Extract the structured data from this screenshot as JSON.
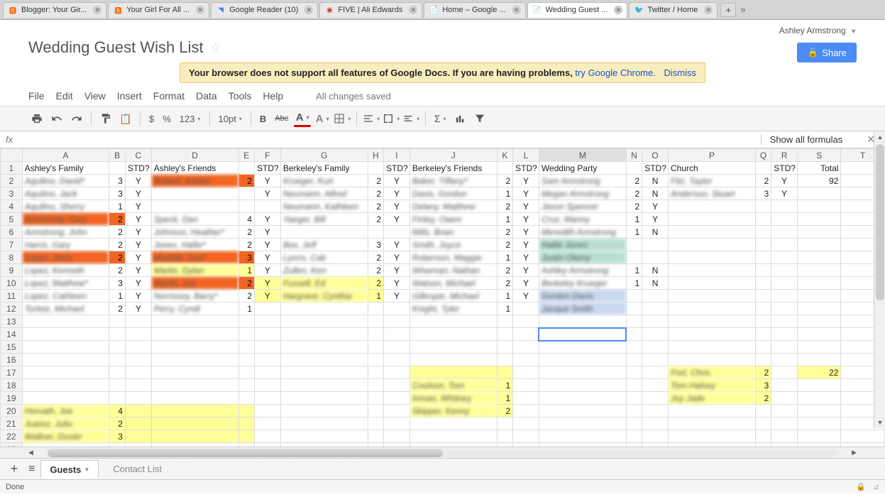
{
  "browser_tabs": [
    {
      "label": "Blogger: Your Gir...",
      "favicon": "🅱",
      "favcolor": "#ff6600"
    },
    {
      "label": "Your Girl For All ...",
      "favicon": "🅱",
      "favcolor": "#ff6600"
    },
    {
      "label": "Google Reader (10)",
      "favicon": "◥",
      "favcolor": "#4285f4"
    },
    {
      "label": "FIVE | Ali Edwards",
      "favicon": "◉",
      "favcolor": "#c0392b"
    },
    {
      "label": "Home – Google ...",
      "favicon": "📄",
      "favcolor": "#4285f4"
    },
    {
      "label": "Wedding Guest ...",
      "favicon": "📄",
      "favcolor": "#4285f4",
      "active": true
    },
    {
      "label": "Twitter / Home",
      "favicon": "🐦",
      "favcolor": "#1da1f2"
    }
  ],
  "user_name": "Ashley Armstrong",
  "doc_title": "Wedding Guest Wish List",
  "share_label": "Share",
  "warning": {
    "text": "Your browser does not support all features of Google Docs. If you are having problems, ",
    "link_text": "try Google Chrome.",
    "dismiss": "Dismiss"
  },
  "menus": [
    "File",
    "Edit",
    "View",
    "Insert",
    "Format",
    "Data",
    "Tools",
    "Help"
  ],
  "save_status": "All changes saved",
  "toolbar": {
    "currency": "$",
    "percent": "%",
    "numfmt": "123",
    "fontsize": "10pt",
    "bold": "B",
    "strike": "Abc"
  },
  "show_formulas": "Show all formulas",
  "columns": [
    "A",
    "B",
    "C",
    "D",
    "E",
    "F",
    "G",
    "H",
    "I",
    "J",
    "K",
    "L",
    "M",
    "N",
    "O",
    "P",
    "Q",
    "R",
    "S",
    "T"
  ],
  "chart_data": {
    "type": "table",
    "title": "Wedding Guest Wish List",
    "headers_row": {
      "A": "Ashley's Family",
      "C": "STD?",
      "D": "Ashley's Friends",
      "F": "STD?",
      "G": "Berkeley's Family",
      "I": "STD?",
      "J": "Berkeley's Friends",
      "L": "STD?",
      "M": "Wedding Party",
      "O": "STD?",
      "P": "Church",
      "R": "STD?",
      "S": "Total"
    },
    "rows": [
      {
        "r": 2,
        "A": "Aquilino, David*",
        "B": "3",
        "C": "Y",
        "D": "Bullard, Ashley",
        "E": "2",
        "F": "Y",
        "G": "Krueger, Kurt",
        "H": "2",
        "I": "Y",
        "J": "Baker, Tiffany*",
        "K": "2",
        "L": "Y",
        "M": "Sam Armstrong",
        "N": "2",
        "O": "N",
        "P": "Fitz, Taylor",
        "Q": "2",
        "R": "Y",
        "S": "92",
        "hl": {
          "D": "orange",
          "E": "orange"
        }
      },
      {
        "r": 3,
        "A": "Aquilino, Jack",
        "B": "3",
        "C": "Y",
        "F": "Y",
        "G": "Neumann, Alfred",
        "H": "2",
        "I": "Y",
        "J": "Davis, Gordon",
        "K": "1",
        "L": "Y",
        "M": "Megan Armstrong",
        "N": "2",
        "O": "N",
        "P": "Anderson, Stuart",
        "Q": "3",
        "R": "Y"
      },
      {
        "r": 4,
        "A": "Aquilino, Sherry",
        "B": "1",
        "C": "Y",
        "G": "Neumann, Kathleen",
        "H": "2",
        "I": "Y",
        "J": "Delany, Matthew",
        "K": "2",
        "L": "Y",
        "M": "Jason Spencer",
        "N": "2",
        "O": "Y"
      },
      {
        "r": 5,
        "A": "Armstrong, Gary",
        "B": "2",
        "C": "Y",
        "D": "Speck, Dan",
        "E": "4",
        "F": "Y",
        "G": "Yaeger, Bill",
        "H": "2",
        "I": "Y",
        "J": "Finley, Owen",
        "K": "1",
        "L": "Y",
        "M": "Cruz, Manny",
        "N": "1",
        "O": "Y",
        "hl": {
          "A": "orange",
          "B": "orange"
        }
      },
      {
        "r": 6,
        "A": "Armstrong, John",
        "B": "2",
        "C": "Y",
        "D": "Johnson, Heather*",
        "E": "2",
        "F": "Y",
        "J": "Mills, Brian",
        "K": "2",
        "L": "Y",
        "M": "Meredith Armstrong",
        "N": "1",
        "O": "N"
      },
      {
        "r": 7,
        "A": "Harris, Gary",
        "B": "2",
        "C": "Y",
        "D": "Jones, Hallie*",
        "E": "2",
        "F": "Y",
        "G": "Box, Jeff",
        "H": "3",
        "I": "Y",
        "J": "Smith, Joyce",
        "K": "2",
        "L": "Y",
        "M": "Hallie Jones",
        "hl": {
          "M": "teal"
        }
      },
      {
        "r": 8,
        "A": "Lopez, Janis",
        "B": "2",
        "C": "Y",
        "D": "Marfold, Suzi*",
        "E": "3",
        "F": "Y",
        "G": "Lyons, Cab",
        "H": "2",
        "I": "Y",
        "J": "Roberson, Maggie",
        "K": "1",
        "L": "Y",
        "M": "Justin Okeny",
        "hl": {
          "A": "orange",
          "B": "orange",
          "D": "orange",
          "E": "orange",
          "M": "teal"
        }
      },
      {
        "r": 9,
        "A": "Lopez, Kenneth",
        "B": "2",
        "C": "Y",
        "D": "Martin, Dylan",
        "E": "1",
        "F": "Y",
        "G": "Zullen, Ken",
        "H": "2",
        "I": "Y",
        "J": "Wiseman, Nathan",
        "K": "2",
        "L": "Y",
        "M": "Ashley Armstrong",
        "N": "1",
        "O": "N",
        "hl": {
          "D": "yellow",
          "E": "yellow"
        }
      },
      {
        "r": 10,
        "A": "Lopez, Matthew*",
        "B": "3",
        "C": "Y",
        "D": "Martin, Joe",
        "E": "2",
        "F": "Y",
        "G": "Fussell, Ed",
        "H": "2",
        "I": "Y",
        "J": "Watson, Michael",
        "K": "2",
        "L": "Y",
        "M": "Berkeley Krueger",
        "N": "1",
        "O": "N",
        "hl": {
          "D": "orange",
          "E": "orange",
          "F": "yellow",
          "G": "yellow",
          "H": "yellow"
        }
      },
      {
        "r": 11,
        "A": "Lopez, Cathleen",
        "B": "1",
        "C": "Y",
        "D": "Norrissey, Barry*",
        "E": "2",
        "F": "Y",
        "G": "Hargrave, Cynthia",
        "H": "1",
        "I": "Y",
        "J": "Gillespie, Michael",
        "K": "1",
        "L": "Y",
        "M": "Gordon Davis",
        "hl": {
          "F": "yellow",
          "G": "yellow",
          "H": "yellow",
          "M": "blue"
        }
      },
      {
        "r": 12,
        "A": "Torletz, Michael",
        "B": "2",
        "C": "Y",
        "D": "Perry, Cyndi",
        "E": "1",
        "J": "Knight, Tyler",
        "K": "1",
        "M": "Jacque Smith",
        "hl": {
          "M": "blue"
        }
      },
      {
        "r": 13
      },
      {
        "r": 14,
        "sel": "M"
      },
      {
        "r": 15
      },
      {
        "r": 16
      },
      {
        "r": 17,
        "P": "Fort, Chris",
        "Q": "2",
        "S": "22",
        "hl": {
          "J": "yellow",
          "K": "yellow",
          "P": "yellow",
          "Q": "yellow",
          "S": "yellow"
        }
      },
      {
        "r": 18,
        "J": "Coulson, Tom",
        "K": "1",
        "P": "Tom Halsey",
        "Q": "3",
        "hl": {
          "J": "yellow",
          "K": "yellow",
          "P": "yellow",
          "Q": "yellow"
        }
      },
      {
        "r": 19,
        "J": "Inman, Whitney",
        "K": "1",
        "P": "Joy Jade",
        "Q": "2",
        "hl": {
          "J": "yellow",
          "K": "yellow",
          "P": "yellow",
          "Q": "yellow"
        }
      },
      {
        "r": 20,
        "A": "Horvath, Joe",
        "B": "4",
        "J": "Skipper, Kenny",
        "K": "2",
        "hl": {
          "A": "yellow",
          "B": "yellow",
          "C": "yellow",
          "D": "yellow",
          "E": "yellow",
          "J": "yellow",
          "K": "yellow"
        }
      },
      {
        "r": 21,
        "A": "Juarez, Julio",
        "B": "2",
        "hl": {
          "A": "yellow",
          "B": "yellow",
          "C": "yellow",
          "D": "yellow",
          "E": "yellow"
        }
      },
      {
        "r": 22,
        "A": "Wallner, Dustin",
        "B": "3",
        "hl": {
          "A": "yellow",
          "B": "yellow",
          "C": "yellow",
          "D": "yellow",
          "E": "yellow"
        }
      },
      {
        "r": 23
      }
    ]
  },
  "sheet_tabs": {
    "active": "Guests",
    "inactive": "Contact List"
  },
  "status": "Done"
}
